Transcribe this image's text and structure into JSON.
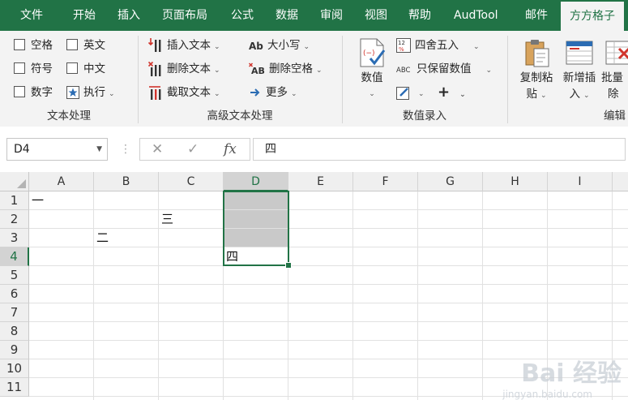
{
  "tabs": [
    "文件",
    "开始",
    "插入",
    "页面布局",
    "公式",
    "数据",
    "审阅",
    "视图",
    "帮助",
    "AudTool",
    "邮件",
    "方方格子"
  ],
  "active_tab": "方方格子",
  "ribbon": {
    "text_group": {
      "checkboxes": [
        "空格",
        "英文",
        "符号",
        "中文",
        "数字"
      ],
      "execute": "执行",
      "label": "文本处理"
    },
    "advanced_group": {
      "items": [
        "插入文本",
        "删除文本",
        "截取文本",
        "大小写",
        "删除空格",
        "更多"
      ],
      "label": "高级文本处理"
    },
    "number_group": {
      "big_button": "数值",
      "items": [
        "四舍五入",
        "只保留数值"
      ],
      "label": "数值录入"
    },
    "edit_group": {
      "buttons": [
        {
          "line1": "复制粘",
          "line2": "贴"
        },
        {
          "line1": "新增插",
          "line2": "入"
        },
        {
          "line1": "批量",
          "line2": "除"
        }
      ],
      "label": "编辑"
    }
  },
  "formula_bar": {
    "name_box": "D4",
    "fx": "fx",
    "value": "四"
  },
  "columns": [
    "A",
    "B",
    "C",
    "D",
    "E",
    "F",
    "G",
    "H",
    "I"
  ],
  "rows": [
    "1",
    "2",
    "3",
    "4",
    "5",
    "6",
    "7",
    "8",
    "9",
    "10",
    "11"
  ],
  "cells": {
    "A1": "一",
    "C2": "三",
    "B3": "二",
    "D4": "四"
  },
  "watermark": {
    "brand": "Bai 经验",
    "url": "jingyan.baidu.com"
  },
  "colors": {
    "accent": "#217346",
    "highlight": "#c9c9c9"
  }
}
